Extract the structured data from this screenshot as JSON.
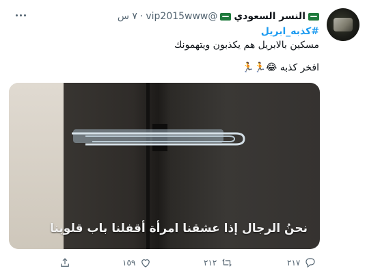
{
  "tweet": {
    "display_name": "النسر السعودي",
    "handle": "@vip2015www",
    "separator": "·",
    "time": "٧ س",
    "hashtag": "#كذبه_ابريل",
    "line1": "مسكين بالابريل هم يكذبون ويتهمونك",
    "line2": "افخر كذبه 😂🏃🏃",
    "media_caption": "نحنُ الرجال إذا عشقنا امرأة أقفلنا باب قلوبنا",
    "reply_count": "٢١٧",
    "retweet_count": "٢١٢",
    "like_count": "١٥٩"
  },
  "icons": {
    "avatar": "avatar-image",
    "flag": "saudi-flag-emoji",
    "more": "more-options-icon",
    "reply": "reply-icon",
    "retweet": "retweet-icon",
    "like": "like-icon",
    "share": "share-icon"
  },
  "colors": {
    "accent": "#1d9bf0",
    "text": "#0f1419",
    "muted": "#536471"
  }
}
